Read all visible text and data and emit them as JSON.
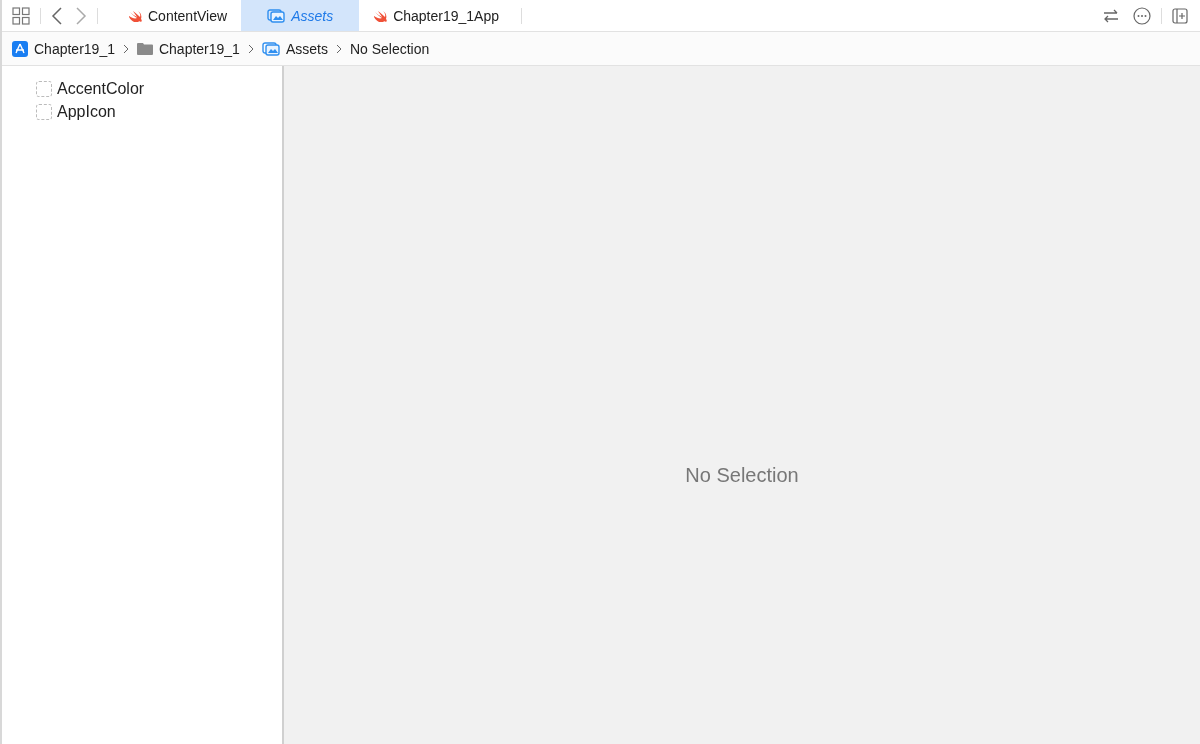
{
  "tabs": [
    {
      "label": "ContentView",
      "kind": "swift",
      "selected": false
    },
    {
      "label": "Assets",
      "kind": "assets",
      "selected": true
    },
    {
      "label": "Chapter19_1App",
      "kind": "swift",
      "selected": false
    }
  ],
  "breadcrumb": [
    {
      "label": "Chapter19_1",
      "kind": "app"
    },
    {
      "label": "Chapter19_1",
      "kind": "folder"
    },
    {
      "label": "Assets",
      "kind": "assets"
    },
    {
      "label": "No Selection",
      "kind": "none"
    }
  ],
  "asset_list": [
    {
      "name": "AccentColor"
    },
    {
      "name": "AppIcon"
    }
  ],
  "detail": {
    "message": "No Selection"
  }
}
